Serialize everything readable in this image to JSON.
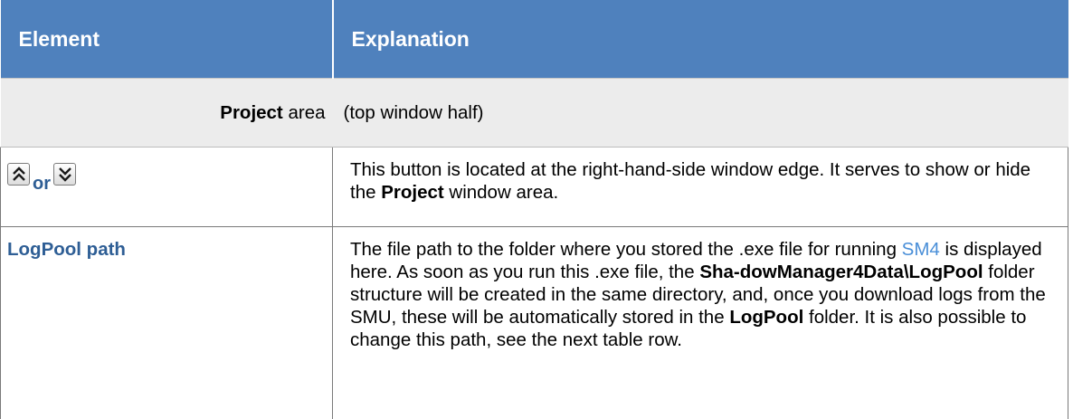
{
  "table": {
    "headers": [
      "Element",
      "Explanation"
    ],
    "section": {
      "label_bold": "Project",
      "label_rest": " area",
      "text": "(top window half)"
    },
    "row1": {
      "or_text": "or",
      "expand_icon": "double-chevron-up-icon",
      "collapse_icon": "double-chevron-down-icon",
      "text_1": "This button is located at the right-hand-side window edge. It serves to show or hide the ",
      "bold_1": "Project",
      "text_2": " window area."
    },
    "row2": {
      "element": "LogPool path",
      "t1": "The file path to the folder where you stored the .exe file for running ",
      "link": "SM4",
      "t2": " is displayed here. As soon as you run this .exe file, the ",
      "b1": "Sha-dowManager4Data\\LogPool",
      "t3": " folder structure will be created in the same directory, and, once you download logs from the SMU, these will be automatically stored in the ",
      "b2": "LogPool",
      "t4": " folder. It is also possible to change this path, see the next table row."
    }
  },
  "colors": {
    "header_bg": "#4f81bd",
    "section_bg": "#ececec",
    "element_text": "#2e5e95",
    "link": "#4a8fd8"
  }
}
